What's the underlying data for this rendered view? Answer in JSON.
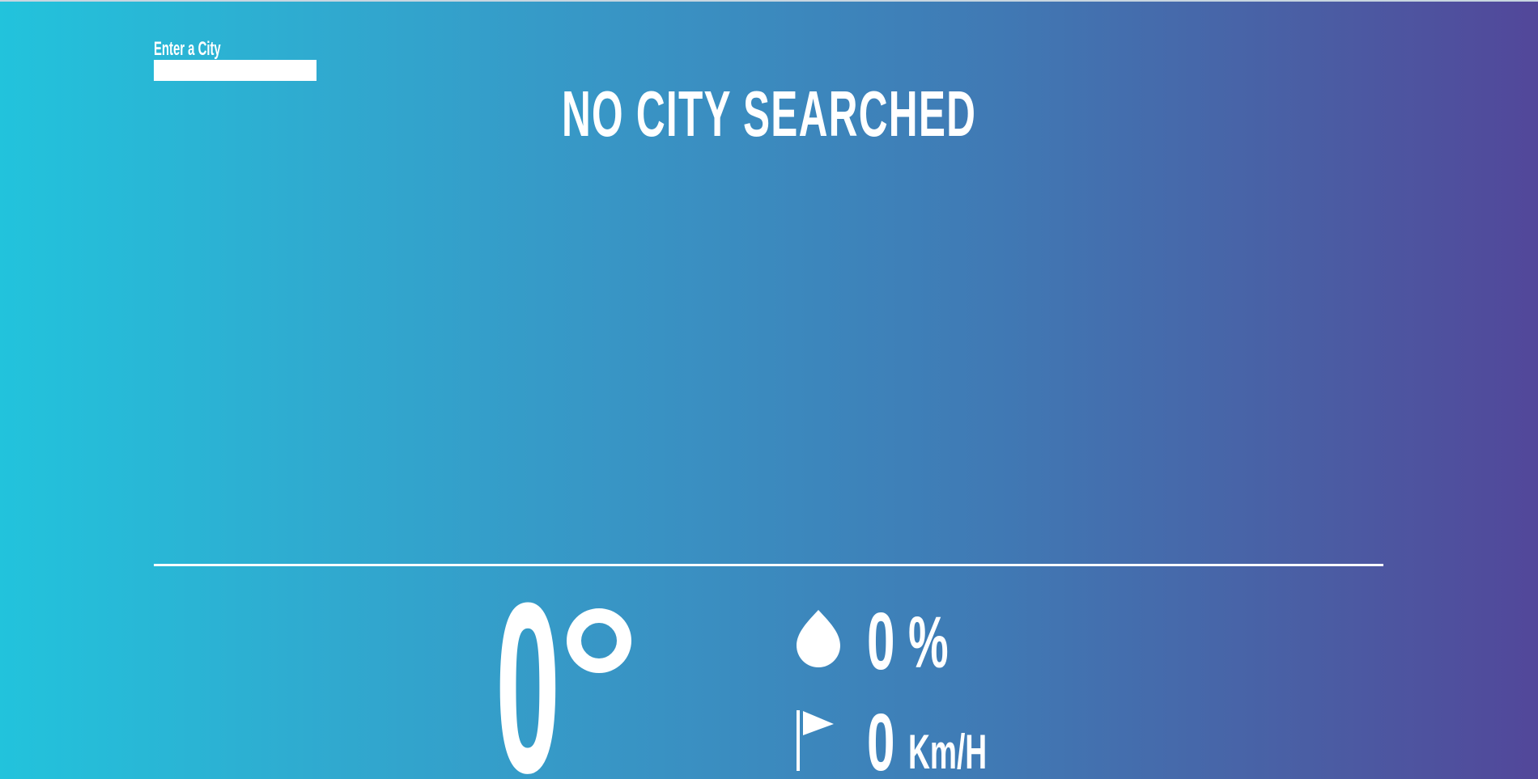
{
  "search": {
    "label": "Enter a City",
    "value": "",
    "placeholder": ""
  },
  "city": {
    "title": "NO CITY SEARCHED"
  },
  "weather": {
    "temperature": "0",
    "degree_icon": "degree-circle-icon",
    "humidity": {
      "icon": "water-drop-icon",
      "value": "0",
      "unit": "%"
    },
    "wind": {
      "icon": "flag-icon",
      "value": "0",
      "unit": "Km/H"
    }
  },
  "colors": {
    "gradient_start": "#22c3dc",
    "gradient_end": "#52479a",
    "text": "#ffffff"
  }
}
